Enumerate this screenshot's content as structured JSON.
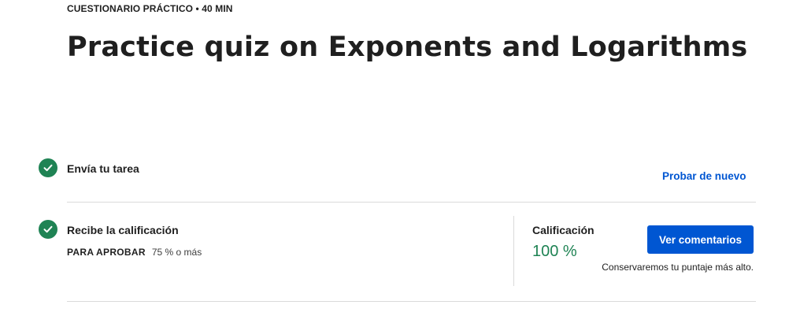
{
  "header": {
    "eyebrow": "CUESTIONARIO PRÁCTICO • 40 MIN",
    "title": "Practice quiz on Exponents and Logarithms"
  },
  "steps": [
    {
      "label": "Envía tu tarea",
      "status_icon": "check-circle-icon",
      "action_label": "Probar de nuevo"
    },
    {
      "label": "Recibe la calificación",
      "status_icon": "check-circle-icon",
      "pass_key": "PARA APROBAR",
      "pass_value": "75 % o más"
    }
  ],
  "grade": {
    "label": "Calificación",
    "value": "100 %",
    "feedback_button": "Ver comentarios",
    "note": "Conservaremos tu puntaje más alto."
  },
  "colors": {
    "accent_blue": "#0056d2",
    "success_green": "#1f8354",
    "divider": "#dadada"
  }
}
